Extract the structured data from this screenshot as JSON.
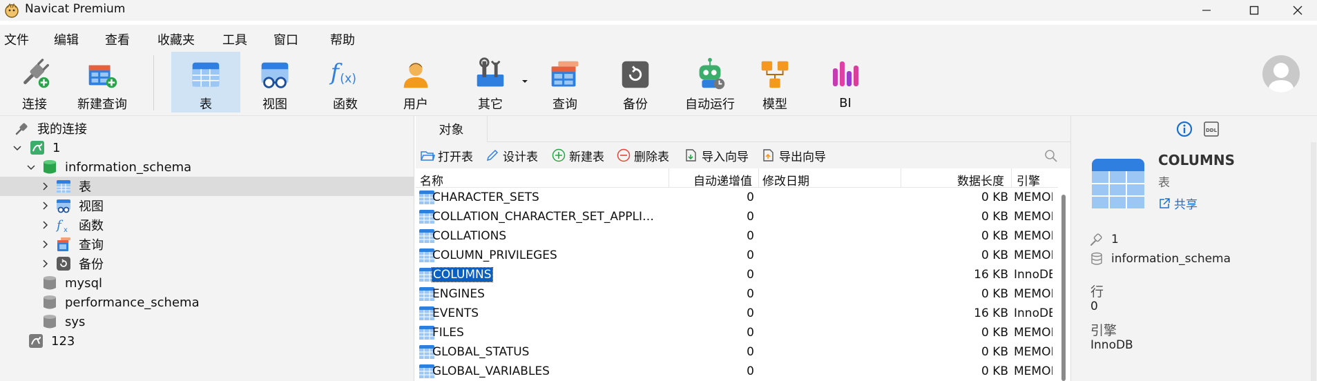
{
  "window": {
    "title": "Navicat Premium",
    "colors": {
      "chrome": "#f3f3f3",
      "selection": "#0a5fbf",
      "accent": "#1a6fd1"
    }
  },
  "menu": [
    "文件",
    "编辑",
    "查看",
    "收藏夹",
    "工具",
    "窗口",
    "帮助"
  ],
  "toolbar": {
    "items": [
      {
        "label": "连接",
        "icon": "plug-add-icon"
      },
      {
        "label": "新建查询",
        "icon": "new-query-icon"
      },
      {
        "label": "表",
        "icon": "table-icon",
        "active": true
      },
      {
        "label": "视图",
        "icon": "view-icon"
      },
      {
        "label": "函数",
        "icon": "function-icon"
      },
      {
        "label": "用户",
        "icon": "user-icon"
      },
      {
        "label": "其它",
        "icon": "tools-icon"
      },
      {
        "label": "查询",
        "icon": "query-icon"
      },
      {
        "label": "备份",
        "icon": "backup-icon"
      },
      {
        "label": "自动运行",
        "icon": "robot-icon"
      },
      {
        "label": "模型",
        "icon": "model-icon"
      },
      {
        "label": "BI",
        "icon": "bi-icon"
      }
    ]
  },
  "tree": {
    "root_label": "我的连接",
    "conn1": "1",
    "db_info": "information_schema",
    "node_tables": "表",
    "node_views": "视图",
    "node_functions": "函数",
    "node_queries": "查询",
    "node_backups": "备份",
    "db_mysql": "mysql",
    "db_perf": "performance_schema",
    "db_sys": "sys",
    "conn2": "123"
  },
  "objects": {
    "tab_label": "对象",
    "actions": {
      "open": "打开表",
      "design": "设计表",
      "new": "新建表",
      "delete": "删除表",
      "import": "导入向导",
      "export": "导出向导"
    },
    "columns": {
      "name": "名称",
      "autoinc": "自动递增值",
      "modified": "修改日期",
      "datalen": "数据长度",
      "engine": "引擎"
    },
    "rows": [
      {
        "name": "CHARACTER_SETS",
        "autoinc": "0",
        "datalen": "0 KB",
        "engine": "MEMORY"
      },
      {
        "name": "COLLATION_CHARACTER_SET_APPLI…",
        "autoinc": "0",
        "datalen": "0 KB",
        "engine": "MEMORY"
      },
      {
        "name": "COLLATIONS",
        "autoinc": "0",
        "datalen": "0 KB",
        "engine": "MEMORY"
      },
      {
        "name": "COLUMN_PRIVILEGES",
        "autoinc": "0",
        "datalen": "0 KB",
        "engine": "MEMORY"
      },
      {
        "name": "COLUMNS",
        "autoinc": "0",
        "datalen": "16 KB",
        "engine": "InnoDB",
        "selected": true
      },
      {
        "name": "ENGINES",
        "autoinc": "0",
        "datalen": "0 KB",
        "engine": "MEMORY"
      },
      {
        "name": "EVENTS",
        "autoinc": "0",
        "datalen": "16 KB",
        "engine": "InnoDB"
      },
      {
        "name": "FILES",
        "autoinc": "0",
        "datalen": "0 KB",
        "engine": "MEMORY"
      },
      {
        "name": "GLOBAL_STATUS",
        "autoinc": "0",
        "datalen": "0 KB",
        "engine": "MEMORY"
      },
      {
        "name": "GLOBAL_VARIABLES",
        "autoinc": "0",
        "datalen": "0 KB",
        "engine": "MEMORY"
      }
    ]
  },
  "details": {
    "tab_info_icon": "info-icon",
    "tab_ddl_icon": "ddl-icon",
    "ddl_text": "DDL",
    "name": "COLUMNS",
    "type": "表",
    "share": "共享",
    "connection": "1",
    "database": "information_schema",
    "rows_label": "行",
    "rows_value": "0",
    "engine_label": "引擎",
    "engine_value": "InnoDB"
  }
}
